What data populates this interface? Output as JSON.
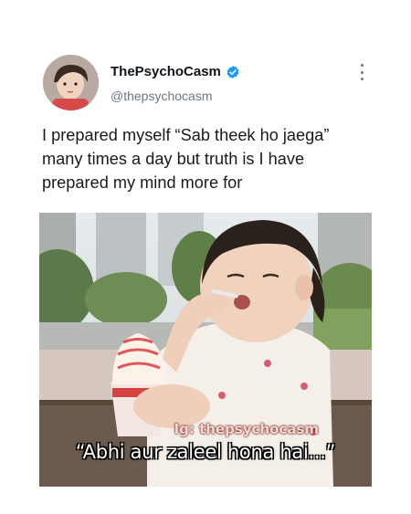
{
  "author": {
    "display_name": "ThePsychoCasm",
    "handle": "@thepsychocasm",
    "verified_icon": "verified-badge-icon",
    "avatar_icon": "child-avatar"
  },
  "menu": {
    "icon": "more-vertical-icon"
  },
  "tweet": {
    "text": "I prepared myself “Sab theek ho jaega” many times a day but truth is I have prepared my mind more for"
  },
  "media": {
    "watermark": "Ig: thepsychocasm",
    "caption": "“Abhi aur zaleel hona hai...”"
  },
  "colors": {
    "verified": "#1d9bf0",
    "handle": "#6e7781",
    "text": "#1a1a1a"
  }
}
